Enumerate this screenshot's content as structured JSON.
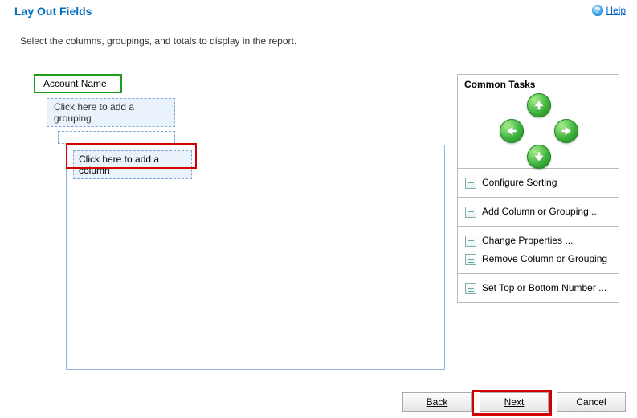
{
  "header": {
    "title": "Lay Out Fields",
    "help_label": "Help"
  },
  "instruction": "Select the columns, groupings, and totals to display in the report.",
  "fields": {
    "account_name": "Account Name",
    "add_grouping": "Click here to add a grouping",
    "add_column": "Click here to add a column"
  },
  "tasks": {
    "title": "Common Tasks",
    "configure_sorting": "Configure Sorting",
    "add_column_grouping": "Add Column or Grouping ...",
    "change_properties": "Change Properties ...",
    "remove_column": "Remove Column or Grouping",
    "set_top_bottom": "Set Top or Bottom Number ..."
  },
  "buttons": {
    "back": "Back",
    "next": "Next",
    "cancel": "Cancel"
  },
  "glyphs": {
    "help": "?"
  }
}
